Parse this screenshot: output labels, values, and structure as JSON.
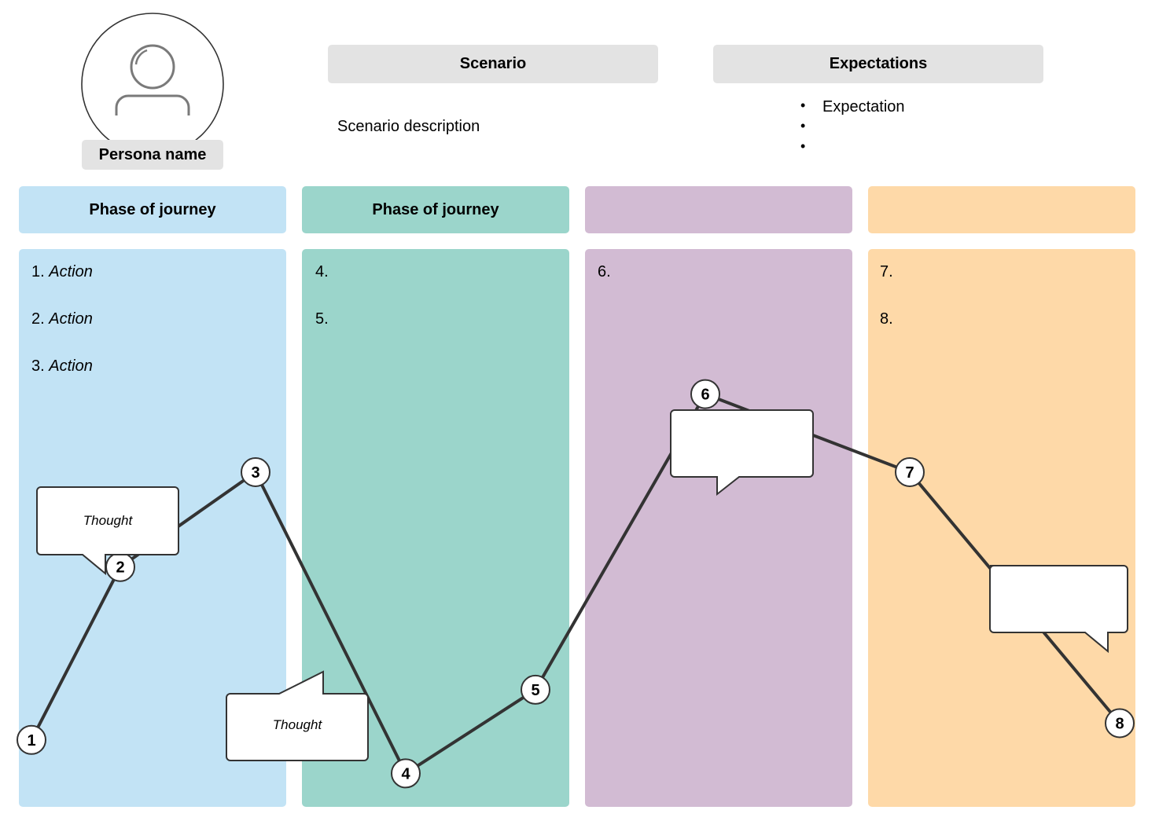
{
  "persona": {
    "name": "Persona name",
    "icon": "user-avatar-icon"
  },
  "scenario": {
    "title": "Scenario",
    "description": "Scenario description"
  },
  "expectations": {
    "title": "Expectations",
    "items": [
      "Expectation",
      "",
      ""
    ]
  },
  "colors": {
    "phase_blue": "#c2e3f5",
    "phase_teal": "#9bd5cb",
    "phase_purple": "#d2bbd3",
    "phase_orange": "#fed9a8",
    "header_gray": "#e3e3e3",
    "line": "#333333"
  },
  "phases": [
    {
      "title": "Phase of journey",
      "color": "#c2e3f5",
      "actions": [
        {
          "num": "1.",
          "text": "Action"
        },
        {
          "num": "2.",
          "text": "Action"
        },
        {
          "num": "3.",
          "text": "Action"
        }
      ]
    },
    {
      "title": "Phase of journey",
      "color": "#9bd5cb",
      "actions": [
        {
          "num": "4.",
          "text": ""
        },
        {
          "num": "5.",
          "text": ""
        }
      ]
    },
    {
      "title": "",
      "color": "#d2bbd3",
      "actions": [
        {
          "num": "6.",
          "text": ""
        }
      ]
    },
    {
      "title": "",
      "color": "#fed9a8",
      "actions": [
        {
          "num": "7.",
          "text": ""
        },
        {
          "num": "8.",
          "text": ""
        }
      ]
    }
  ],
  "journey_points": [
    {
      "label": "1",
      "phase": 1,
      "sentiment": 0.12
    },
    {
      "label": "2",
      "phase": 1,
      "sentiment": 0.43
    },
    {
      "label": "3",
      "phase": 1,
      "sentiment": 0.6
    },
    {
      "label": "4",
      "phase": 2,
      "sentiment": 0.06
    },
    {
      "label": "5",
      "phase": 2,
      "sentiment": 0.21
    },
    {
      "label": "6",
      "phase": 3,
      "sentiment": 0.74
    },
    {
      "label": "7",
      "phase": 4,
      "sentiment": 0.6
    },
    {
      "label": "8",
      "phase": 4,
      "sentiment": 0.15
    }
  ],
  "thoughts": [
    {
      "text": "Thought",
      "near_point": "2"
    },
    {
      "text": "Thought",
      "near_point": "4"
    },
    {
      "text": "",
      "near_point": "6"
    },
    {
      "text": "",
      "near_point": "8"
    }
  ]
}
